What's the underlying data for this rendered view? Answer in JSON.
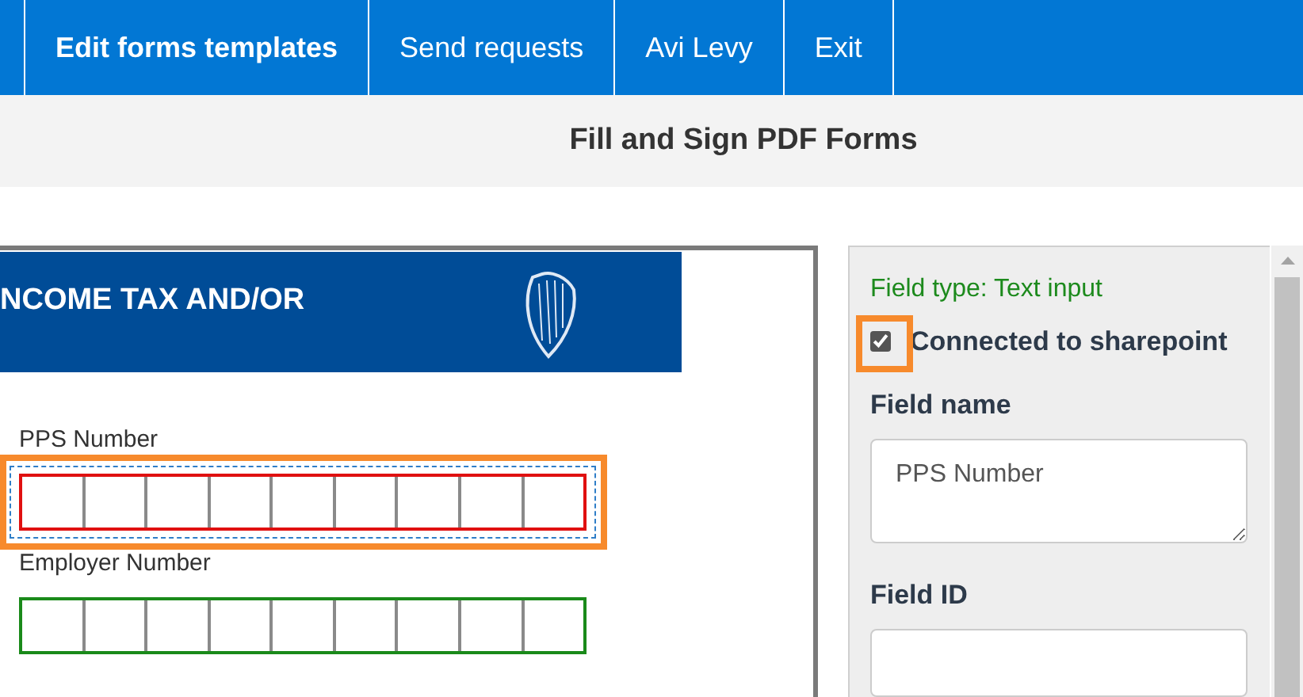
{
  "nav": {
    "tabs": [
      {
        "label": "Edit forms templates",
        "selected": true
      },
      {
        "label": "Send requests",
        "selected": false
      },
      {
        "label": "Avi Levy",
        "selected": false
      },
      {
        "label": "Exit",
        "selected": false
      }
    ]
  },
  "header": {
    "title": "Fill and Sign PDF Forms"
  },
  "document": {
    "banner": "NCOME TAX AND/OR",
    "fields": [
      {
        "label": "PPS Number",
        "selected": true,
        "highlighted": true
      },
      {
        "label": "Employer Number",
        "selected": false,
        "highlighted": false
      }
    ]
  },
  "properties": {
    "field_type": "Field type: Text input",
    "connected": {
      "label": "Connected to sharepoint",
      "checked": true,
      "highlighted": true
    },
    "field_name": {
      "label": "Field name",
      "value": "PPS Number"
    },
    "field_id": {
      "label": "Field ID"
    }
  }
}
